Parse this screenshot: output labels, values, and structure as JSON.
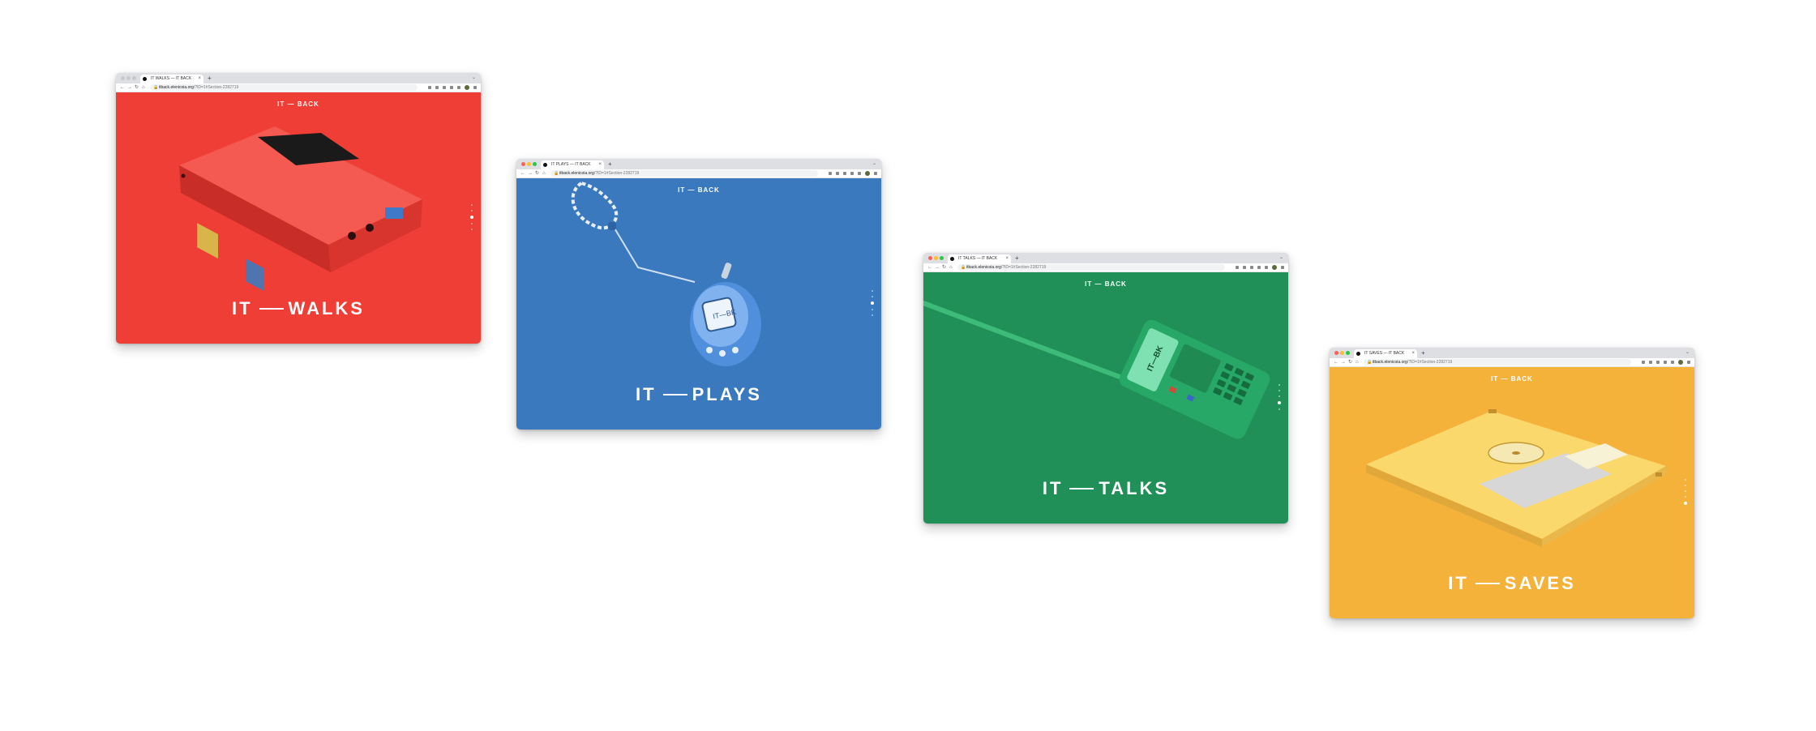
{
  "colors": {
    "red": "#ef3e36",
    "blue": "#3a79bd",
    "green": "#218f58",
    "yellow": "#f4b23a",
    "traffic_close": "#ff5f57",
    "traffic_min": "#febc2e",
    "traffic_max": "#28c840"
  },
  "windows": [
    {
      "tab_title": "IT WALKS — IT BACK",
      "url_host": "itback.elenicoia.org",
      "url_path": "/?ID=1#Section-2282719",
      "site_logo": "IT — BACK",
      "headline_it": "IT",
      "headline_word": "WALKS",
      "illustration": "cassette-player",
      "pager_active": 2
    },
    {
      "tab_title": "IT PLAYS — IT BACK",
      "url_host": "itback.elenicoia.org",
      "url_path": "/?ID=1#Section-2282719",
      "site_logo": "IT — BACK",
      "headline_it": "IT",
      "headline_word": "PLAYS",
      "illustration": "virtual-pet",
      "pager_active": 3
    },
    {
      "tab_title": "IT TALKS — IT BACK",
      "url_host": "itback.elenicoia.org",
      "url_path": "/?ID=1#Section-2282719",
      "site_logo": "IT — BACK",
      "headline_it": "IT",
      "headline_word": "TALKS",
      "illustration": "walkie-talkie",
      "pager_active": 4
    },
    {
      "tab_title": "IT SAVES — IT BACK",
      "url_host": "itback.elenicoia.org",
      "url_path": "/?ID=1#Section-2282719",
      "site_logo": "IT — BACK",
      "headline_it": "IT",
      "headline_word": "SAVES",
      "illustration": "floppy-disk",
      "pager_active": 5
    }
  ]
}
